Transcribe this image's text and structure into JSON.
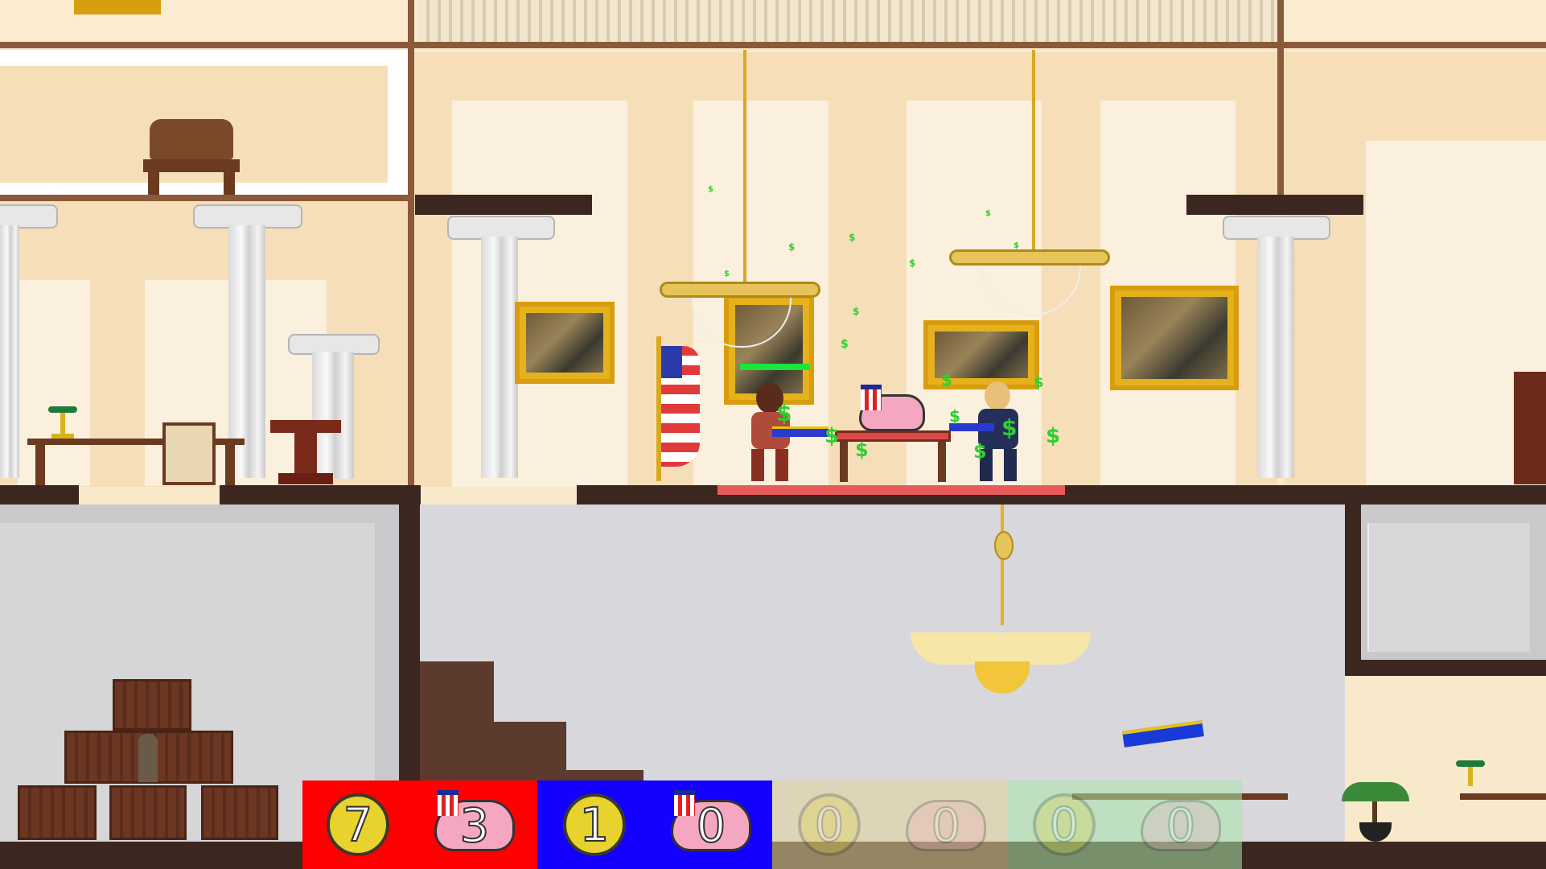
{
  "game": {
    "title": "",
    "colors": {
      "team1_bg": "#ff0000",
      "team2_bg": "#1400ff",
      "team3_bg": "#e0d39a",
      "team4_bg": "#a9e6a9",
      "dollar_green": "#2fcf2f",
      "wall": "#f6dfb8",
      "floor_dark": "#3b2620",
      "basement": "#d5d5d9",
      "carpet": "#e85b5b"
    }
  },
  "hud": {
    "team1": {
      "coins": "7",
      "pigs": "3",
      "active": true
    },
    "team2": {
      "coins": "1",
      "pigs": "0",
      "active": true
    },
    "team3": {
      "coins": "0",
      "pigs": "0",
      "active": false
    },
    "team4": {
      "coins": "0",
      "pigs": "0",
      "active": false
    }
  },
  "icons": {
    "coin": "dollar-coin-icon",
    "pig": "piggy-bank-uncle-sam-hat-icon",
    "rifle": "sniper-rifle-icon",
    "flag": "american-flag-icon"
  },
  "players": [
    {
      "name": "",
      "team": 1,
      "health_fraction": 1.0
    },
    {
      "name": "",
      "team": 2
    }
  ]
}
